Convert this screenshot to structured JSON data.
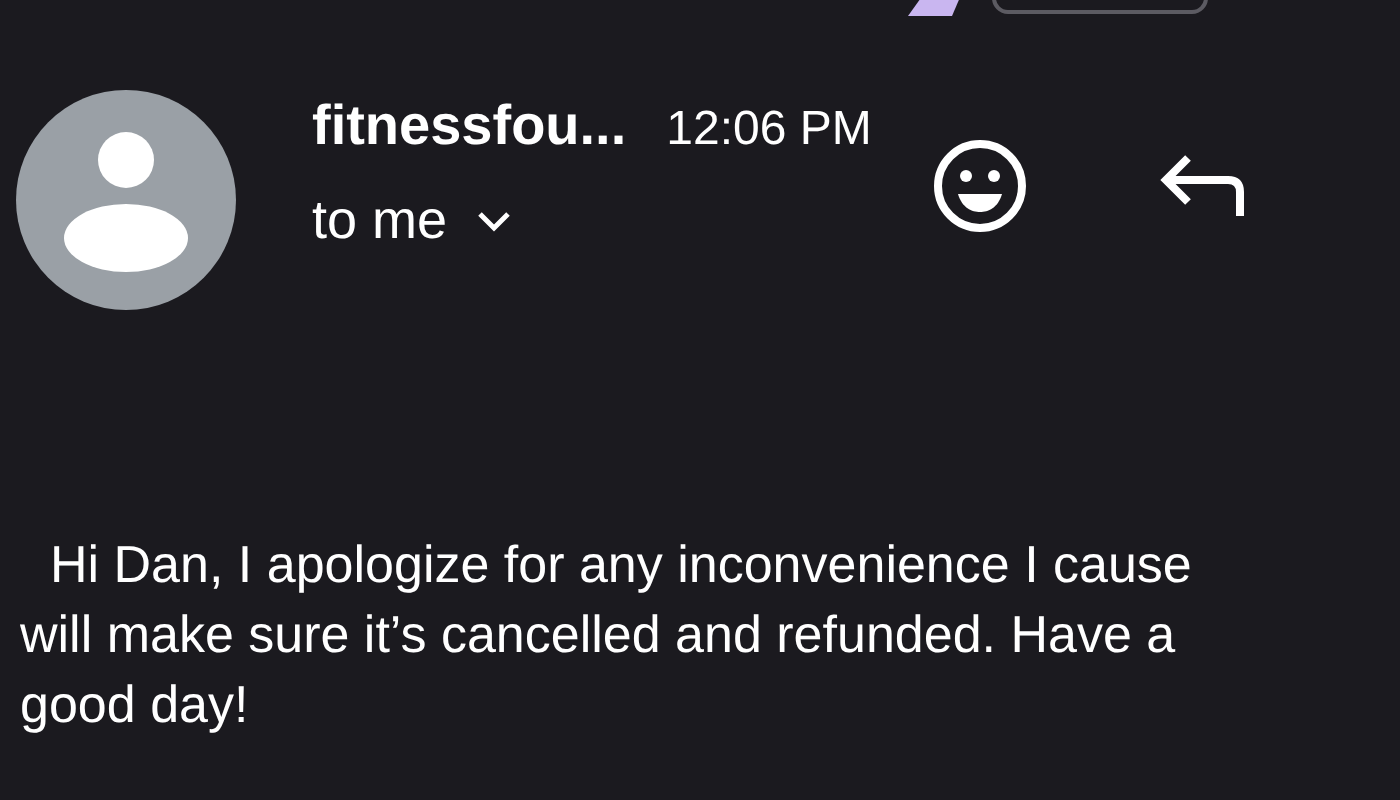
{
  "email": {
    "sender": "fitnessfou...",
    "time": "12:06 PM",
    "recipient": "to me",
    "body_lines": [
      "Hi Dan, I apologize for any inconvenience I cause",
      "will make sure it’s cancelled and refunded. Have a",
      "good day!"
    ]
  }
}
